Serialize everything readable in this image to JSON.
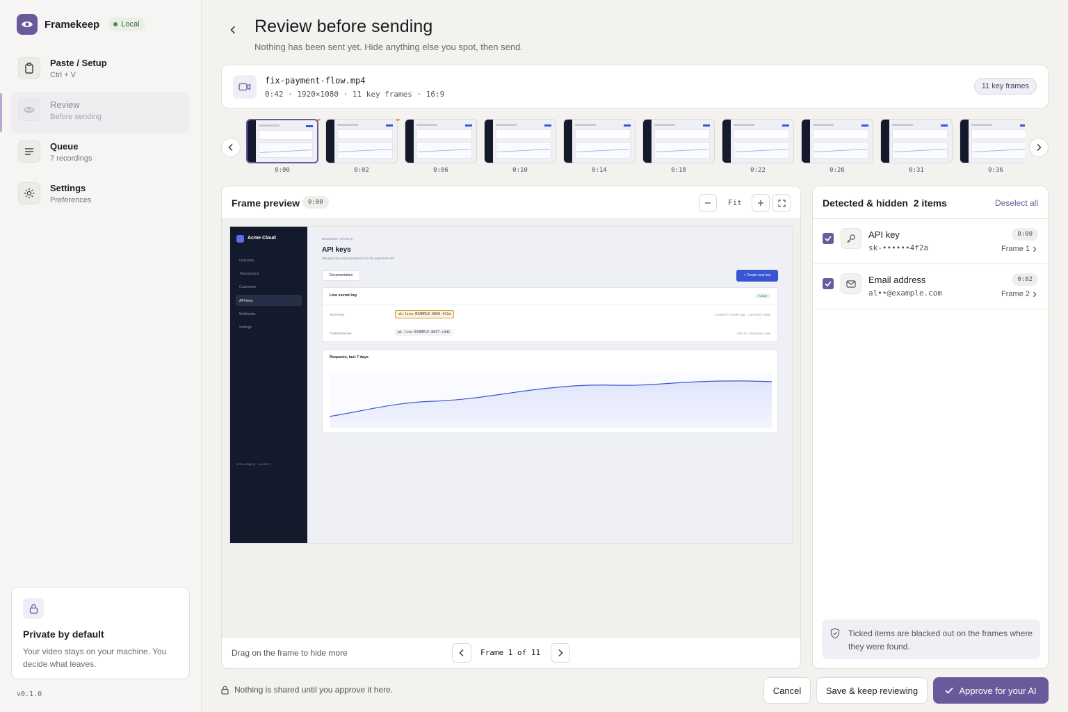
{
  "app": {
    "name": "Framekeep",
    "mode_badge": "Local",
    "version": "v0.1.0"
  },
  "sidebar": {
    "items": [
      {
        "title": "Paste / Setup",
        "subtitle": "Ctrl + V",
        "icon": "clipboard-icon"
      },
      {
        "title": "Review",
        "subtitle": "Before sending",
        "icon": "eye-icon",
        "active": true
      },
      {
        "title": "Queue",
        "subtitle": "7 recordings",
        "icon": "list-icon"
      },
      {
        "title": "Settings",
        "subtitle": "Preferences",
        "icon": "sun-gear-icon"
      }
    ],
    "private_card": {
      "title": "Private by default",
      "body": "Your video stays on your machine. You decide what leaves."
    }
  },
  "header": {
    "title": "Review before sending",
    "subtitle": "Nothing has been sent yet. Hide anything else you spot, then send."
  },
  "file": {
    "name": "fix-payment-flow.mp4",
    "meta": "0:42 · 1920×1080 · 11 key frames · 16:9",
    "badge": "11 key frames"
  },
  "filmstrip": {
    "frames": [
      {
        "time": "0:00",
        "selected": true,
        "flag": true
      },
      {
        "time": "0:02",
        "selected": false,
        "flag": true
      },
      {
        "time": "0:06",
        "selected": false,
        "flag": false
      },
      {
        "time": "0:10",
        "selected": false,
        "flag": false
      },
      {
        "time": "0:14",
        "selected": false,
        "flag": false
      },
      {
        "time": "0:18",
        "selected": false,
        "flag": false
      },
      {
        "time": "0:22",
        "selected": false,
        "flag": false
      },
      {
        "time": "0:26",
        "selected": false,
        "flag": false
      },
      {
        "time": "0:31",
        "selected": false,
        "flag": false
      },
      {
        "time": "0:36",
        "selected": false,
        "flag": false
      }
    ]
  },
  "preview": {
    "title": "Frame preview",
    "time": "0:00",
    "zoom_label": "Fit",
    "hint": "Drag on the frame to hide more",
    "pager": "Frame 1 of 11",
    "frame": {
      "brand": "Acme Cloud",
      "nav": [
        "Overview",
        "Transactions",
        "Customers",
        "API keys",
        "Webhooks",
        "Settings"
      ],
      "active_nav": 3,
      "env": "acme-staging · us-east-1",
      "crumb": "Developers / API keys",
      "title": "API keys",
      "desc": "Manage keys and permissions for the payments API.",
      "docs_button": "Documentation",
      "create_button": "+ Create new key",
      "card_title": "Live secret key",
      "card_status": "Active",
      "rows": [
        {
          "label": "Secret key",
          "value": "sk-live-EXAMPLE-0000-4f2a",
          "meta": "Created 2 months ago · Last used today",
          "redacted": true
        },
        {
          "label": "Publishable key",
          "value": "pk-live-EXAMPLE-8817-c3d1",
          "meta": "Safe for client-side code",
          "redacted": false
        }
      ],
      "chart_title": "Requests, last 7 days"
    }
  },
  "detected": {
    "title": "Detected & hidden",
    "count": "2 items",
    "deselect_label": "Deselect all",
    "items": [
      {
        "label": "API key",
        "value": "sk-••••••4f2a",
        "time": "0:00",
        "frame": "Frame 1",
        "icon": "key-icon",
        "checked": true
      },
      {
        "label": "Email address",
        "value": "al••@example.com",
        "time": "0:02",
        "frame": "Frame 2",
        "icon": "mail-icon",
        "checked": true
      }
    ],
    "note": "Ticked items are blacked out on the frames where they were found."
  },
  "footer": {
    "note": "Nothing is shared until you approve it here.",
    "cancel": "Cancel",
    "save": "Save & keep reviewing",
    "approve": "Approve for your AI"
  },
  "colors": {
    "accent": "#6a5a9c",
    "redaction": "#d89b2b",
    "chart_line": "#3a55d4"
  }
}
